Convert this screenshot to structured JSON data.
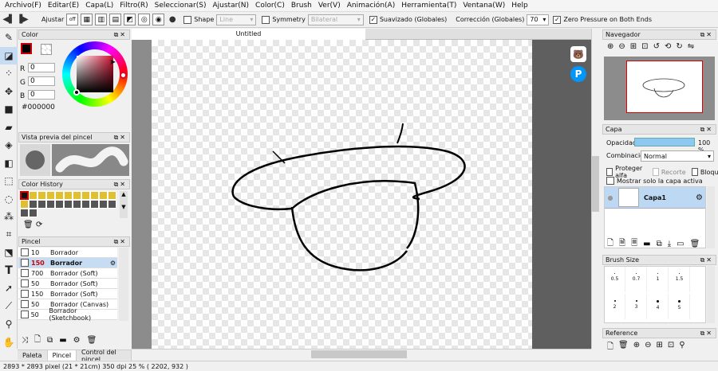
{
  "menu": [
    "Archivo(F)",
    "Editar(E)",
    "Capa(L)",
    "Filtro(R)",
    "Seleccionar(S)",
    "Ajustar(N)",
    "Color(C)",
    "Brush",
    "Ver(V)",
    "Animación(A)",
    "Herramienta(T)",
    "Ventana(W)",
    "Help"
  ],
  "toolbar": {
    "adjust_label": "Ajustar",
    "shape_label": "Shape",
    "shape_value": "Line",
    "symmetry_label": "Symmetry",
    "symmetry_value": "Bilateral",
    "smooth_label": "Suavizado (Globales)",
    "correction_label": "Corrección (Globales)",
    "correction_value": "70",
    "zero_pressure_label": "Zero Pressure on Both Ends",
    "off_label": "off"
  },
  "color_panel": {
    "title": "Color",
    "r_label": "R",
    "r_value": "0",
    "g_label": "G",
    "g_value": "0",
    "b_label": "B",
    "b_value": "0",
    "hex": "#000000"
  },
  "brush_preview": {
    "title": "Vista previa del pincel"
  },
  "color_history": {
    "title": "Color History",
    "swatches": [
      "#111111",
      "#e0c030",
      "#e0c030",
      "#e0c030",
      "#e0c030",
      "#e0c030",
      "#e0c030",
      "#e0c030",
      "#e0c030",
      "#e0c030",
      "#e0c030",
      "#e0c030",
      "#555555",
      "#555555",
      "#555555",
      "#555555",
      "#555555",
      "#555555",
      "#555555",
      "#555555",
      "#555555",
      "#555555",
      "#555555",
      "#555555"
    ]
  },
  "brush_panel": {
    "title": "Pincel",
    "items": [
      {
        "size": "10",
        "name": "Borrador"
      },
      {
        "size": "150",
        "name": "Borrador"
      },
      {
        "size": "700",
        "name": "Borrador (Soft)"
      },
      {
        "size": "50",
        "name": "Borrador (Soft)"
      },
      {
        "size": "150",
        "name": "Borrador (Soft)"
      },
      {
        "size": "50",
        "name": "Borrador (Canvas)"
      },
      {
        "size": "50",
        "name": "Borrador (Sketchbook)"
      }
    ]
  },
  "left_tabs": [
    "Paleta",
    "Pincel",
    "Control del pincel"
  ],
  "canvas": {
    "tab_title": "Untitled"
  },
  "navigator": {
    "title": "Navegador"
  },
  "layer_panel": {
    "title": "Capa",
    "opacity_label": "Opacidad",
    "opacity_value": "100 %",
    "blend_label": "Combinación",
    "blend_value": "Normal",
    "protect_alpha": "Proteger alfa",
    "clip": "Recorte",
    "lock": "Bloquear",
    "show_active_only": "Mostrar solo la capa activa",
    "layer_name": "Capa1"
  },
  "brush_size": {
    "title": "Brush Size",
    "row1": [
      "0.5",
      "0.7",
      "1",
      "1.5"
    ],
    "row2": [
      "2",
      "3",
      "4",
      "5"
    ]
  },
  "reference": {
    "title": "Reference"
  },
  "status": "2893 * 2893 pixel   (21 * 21cm)  350 dpi   25 %   ( 2202, 932 )",
  "colors": {
    "accent": "#c6dcf2",
    "canvas_bg": "#8c8c8c",
    "opacity_bar": "#8cc8f0"
  }
}
